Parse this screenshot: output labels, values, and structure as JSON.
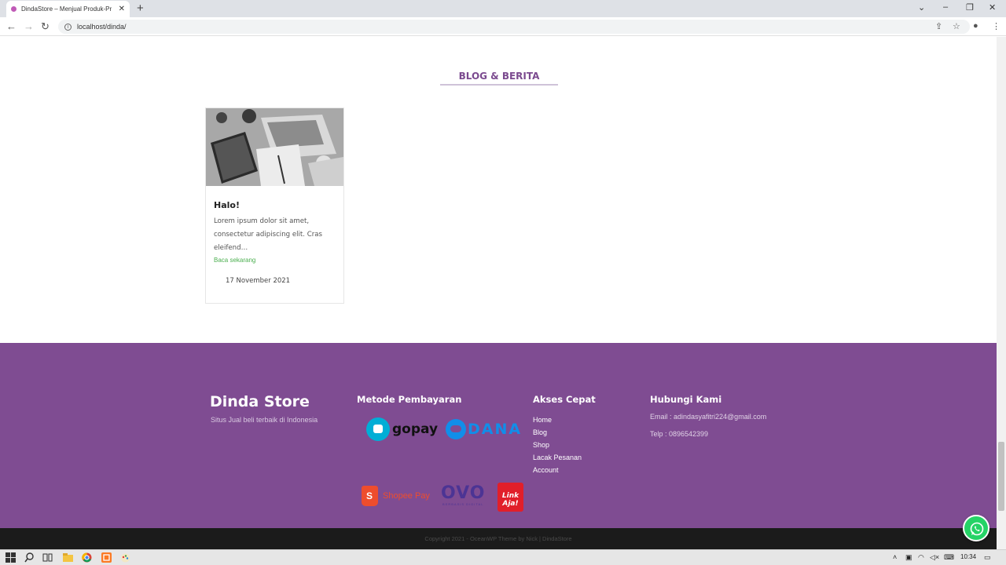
{
  "browser": {
    "tab_title": "DindaStore – Menjual Produk-Pr",
    "tab_close": "✕",
    "new_tab": "+",
    "url": "localhost/dinda/"
  },
  "blog": {
    "section_title": "BLOG & BERITA",
    "post": {
      "title": "Halo!",
      "excerpt": "Lorem ipsum dolor sit amet, consectetur adipiscing elit. Cras eleifend…",
      "read_more": "Baca sekarang",
      "date": "17 November 2021"
    }
  },
  "footer": {
    "brand": "Dinda Store",
    "tagline": "Situs Jual beli terbaik di Indonesia",
    "payment_heading": "Metode Pembayaran",
    "payments": {
      "gopay": "gopay",
      "dana": "DANA",
      "shopeepay": "Shopee Pay",
      "ovo": "OVO",
      "ovo_sub": "BERBASIS DIGITAL",
      "linkaja": "Link Aja!"
    },
    "quick_heading": "Akses Cepat",
    "quick_links": [
      "Home",
      "Blog",
      "Shop",
      "Lacak Pesanan",
      "Account"
    ],
    "contact_heading": "Hubungi Kami",
    "email": "Email : adindasyafitri224@gmail.com",
    "phone": "Telp : 0896542399",
    "copyright": "Copyright 2021 - OceanWP Theme by Nick | DindaStore"
  },
  "taskbar": {
    "clock": "10:34"
  },
  "colors": {
    "footer_bg": "#7f4c92",
    "accent": "#7b4a8f",
    "link_green": "#4caf50",
    "whatsapp": "#25d366"
  }
}
